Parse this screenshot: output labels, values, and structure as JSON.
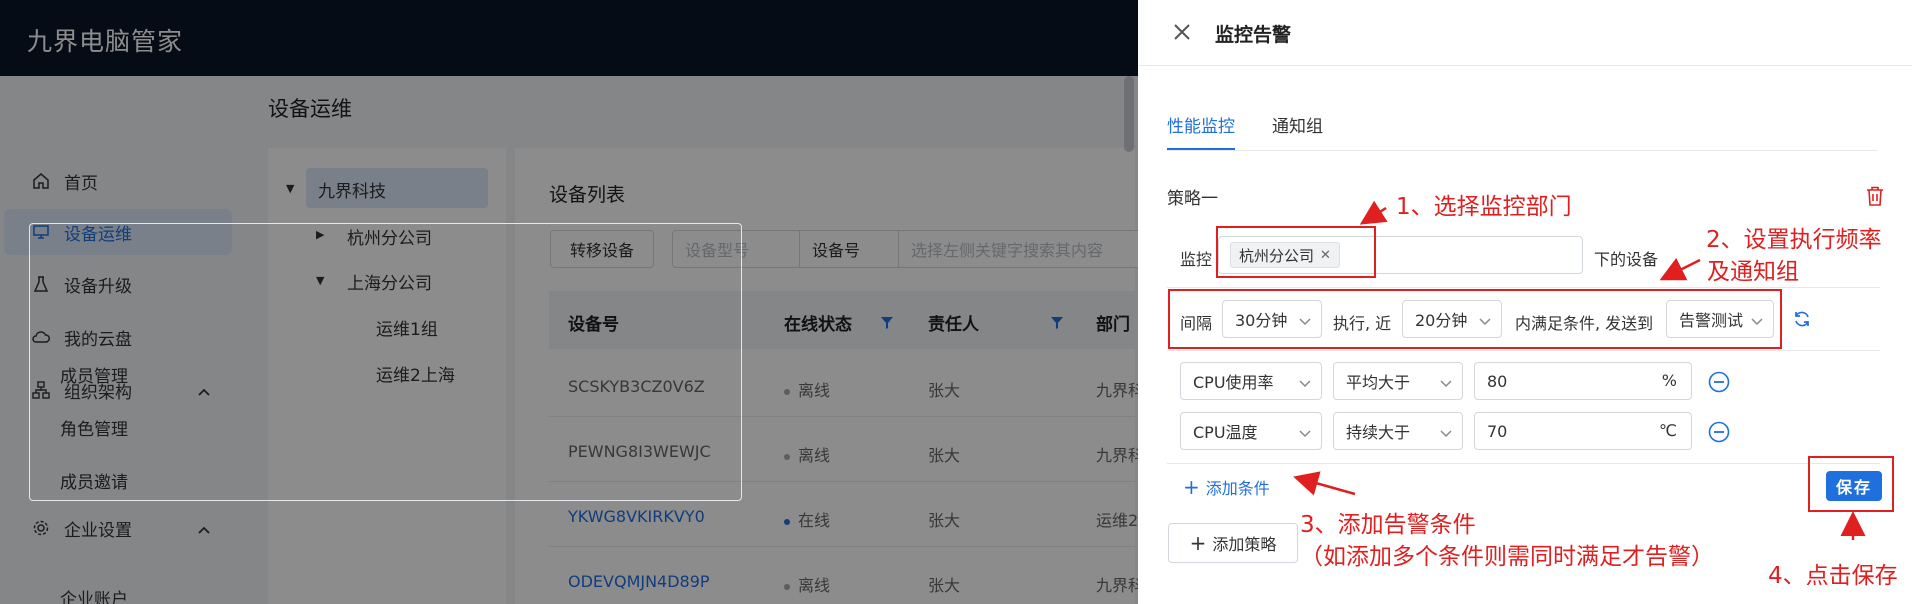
{
  "app": {
    "title": "九界电脑管家"
  },
  "sidebar": {
    "items": [
      {
        "label": "首页",
        "icon": "home-icon"
      },
      {
        "label": "设备运维",
        "icon": "monitor-icon",
        "active": true
      },
      {
        "label": "设备升级",
        "icon": "flask-icon"
      },
      {
        "label": "我的云盘",
        "icon": "cloud-icon"
      },
      {
        "label": "组织架构",
        "icon": "org-icon",
        "expanded": true
      },
      {
        "label": "成员管理"
      },
      {
        "label": "角色管理"
      },
      {
        "label": "成员邀请"
      },
      {
        "label": "企业设置",
        "icon": "gear-icon",
        "expanded": true
      },
      {
        "label": "企业账户"
      }
    ]
  },
  "main": {
    "page_title": "设备运维",
    "tree": [
      "九界科技",
      "杭州分公司",
      "上海分公司",
      "运维1组",
      "运维2上海"
    ],
    "list_title": "设备列表",
    "transfer_button": "转移设备",
    "filter_model_placeholder": "设备型号",
    "filter_field": "设备号",
    "search_placeholder": "选择左侧关键字搜索其内容",
    "columns": [
      "设备号",
      "在线状态",
      "责任人",
      "部门"
    ],
    "rows": [
      {
        "device": "SCSKYB3CZ0V6Z",
        "status": "离线",
        "owner": "张大",
        "dept": "九界科"
      },
      {
        "device": "PEWNG8I3WEWJC",
        "status": "离线",
        "owner": "张大",
        "dept": "九界科"
      },
      {
        "device": "YKWG8VKIRKVY0",
        "status": "在线",
        "owner": "张大",
        "dept": "运维2"
      },
      {
        "device": "ODEVQMJN4D89P",
        "status": "离线",
        "owner": "张大",
        "dept": "九界科"
      }
    ]
  },
  "drawer": {
    "title": "监控告警",
    "tabs": [
      "性能监控",
      "通知组"
    ],
    "strategy_name": "策略一",
    "monitor_label": "监控",
    "monitor_tag": "杭州分公司",
    "device_suffix": "下的设备",
    "interval_label": "间隔",
    "interval_value": "30分钟",
    "exec_label": "执行, 近",
    "window_value": "20分钟",
    "send_label": "内满足条件, 发送到",
    "group_value": "告警测试",
    "conditions": [
      {
        "metric": "CPU使用率",
        "op": "平均大于",
        "value": "80",
        "unit": "%"
      },
      {
        "metric": "CPU温度",
        "op": "持续大于",
        "value": "70",
        "unit": "℃"
      }
    ],
    "add_condition": "添加条件",
    "add_strategy": "添加策略",
    "save": "保存"
  },
  "annotations": {
    "step1": "1、选择监控部门",
    "step2_line1": "2、设置执行频率",
    "step2_line2": "及通知组",
    "step3_line1": "3、添加告警条件",
    "step3_line2": "（如添加多个条件则需同时满足才告警）",
    "step4": "4、点击保存"
  },
  "colors": {
    "accent": "#1f6fde",
    "annotation": "#e02020",
    "topbar": "#0b1729"
  }
}
